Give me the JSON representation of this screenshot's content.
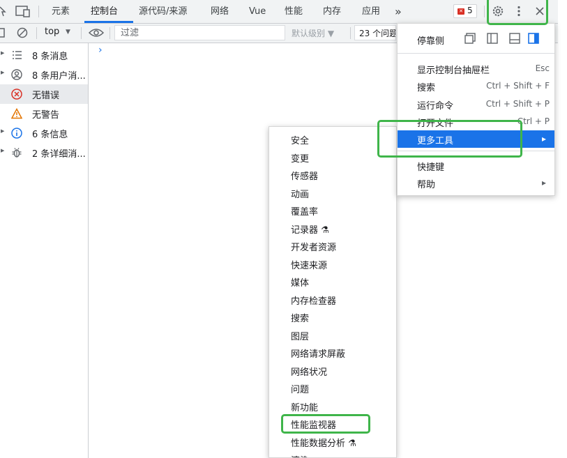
{
  "tabs": [
    {
      "label": "元素"
    },
    {
      "label": "控制台"
    },
    {
      "label": "源代码/来源"
    },
    {
      "label": "网络"
    },
    {
      "label": "Vue"
    },
    {
      "label": "性能"
    },
    {
      "label": "内存"
    },
    {
      "label": "应用"
    }
  ],
  "tabs_more": "»",
  "error_count": "5",
  "toolbar": {
    "context": "top",
    "filter_placeholder": "过滤",
    "levels": "默认级别",
    "issues": "23 个问题"
  },
  "sidebar": [
    {
      "label": "8 条消息",
      "icon": "list-icon"
    },
    {
      "label": "8 条用户消...",
      "icon": "user-icon"
    },
    {
      "label": "无错误",
      "icon": "error-icon"
    },
    {
      "label": "无警告",
      "icon": "warning-icon"
    },
    {
      "label": "6 条信息",
      "icon": "info-icon"
    },
    {
      "label": "2 条详细消...",
      "icon": "bug-icon"
    }
  ],
  "main_menu": {
    "dock_label": "停靠侧",
    "items": [
      {
        "label": "显示控制台抽屉栏",
        "shortcut": "Esc"
      },
      {
        "label": "搜索",
        "shortcut": "Ctrl + Shift + F"
      },
      {
        "label": "运行命令",
        "shortcut": "Ctrl + Shift + P"
      },
      {
        "label": "打开文件",
        "shortcut": "Ctrl + P"
      },
      {
        "label": "更多工具",
        "shortcut": "▸"
      },
      {
        "label": "快捷键",
        "shortcut": ""
      },
      {
        "label": "帮助",
        "shortcut": "▸"
      }
    ]
  },
  "more_tools": [
    {
      "label": "安全"
    },
    {
      "label": "变更"
    },
    {
      "label": "传感器"
    },
    {
      "label": "动画"
    },
    {
      "label": "覆盖率"
    },
    {
      "label": "记录器 ⚗"
    },
    {
      "label": "开发者资源"
    },
    {
      "label": "快速来源"
    },
    {
      "label": "媒体"
    },
    {
      "label": "内存检查器"
    },
    {
      "label": "搜索"
    },
    {
      "label": "图层"
    },
    {
      "label": "网络请求屏蔽"
    },
    {
      "label": "网络状况"
    },
    {
      "label": "问题"
    },
    {
      "label": "新功能"
    },
    {
      "label": "性能监视器"
    },
    {
      "label": "性能数据分析 ⚗"
    },
    {
      "label": "渲染"
    }
  ],
  "colors": {
    "accent": "#1a73e8",
    "highlight_box": "#3fb54a",
    "error": "#d93025",
    "warning": "#e37400"
  }
}
